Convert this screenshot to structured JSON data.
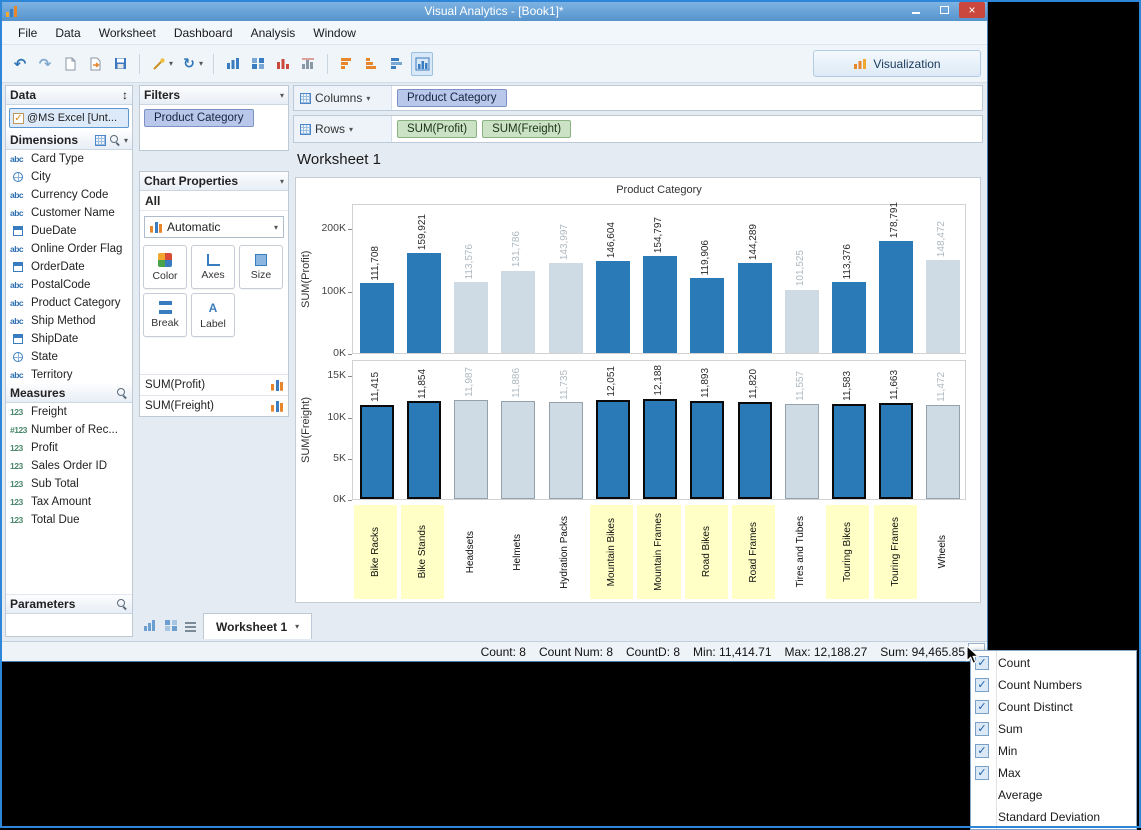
{
  "window": {
    "title": "Visual Analytics - [Book1]*"
  },
  "icons": {
    "caret_down": "▾",
    "updown": "↕",
    "undo": "↶",
    "redo": "↷",
    "refresh": "↻",
    "check": "✓",
    "close": "×"
  },
  "menu_bar": {
    "items": [
      "File",
      "Data",
      "Worksheet",
      "Dashboard",
      "Analysis",
      "Window"
    ]
  },
  "toolbar": {
    "visualization_label": "Visualization"
  },
  "data_panel": {
    "header": "Data",
    "connection": {
      "label": "@MS Excel [Unt...",
      "checked": true
    },
    "dimensions": {
      "header": "Dimensions",
      "fields": [
        {
          "icon": "abc",
          "label": "Card Type"
        },
        {
          "icon": "globe",
          "label": "City"
        },
        {
          "icon": "abc",
          "label": "Currency Code"
        },
        {
          "icon": "abc",
          "label": "Customer Name"
        },
        {
          "icon": "calendar",
          "label": "DueDate"
        },
        {
          "icon": "abc",
          "label": "Online Order Flag"
        },
        {
          "icon": "calendar",
          "label": "OrderDate"
        },
        {
          "icon": "abc",
          "label": "PostalCode"
        },
        {
          "icon": "abc",
          "label": "Product Category"
        },
        {
          "icon": "abc",
          "label": "Ship Method"
        },
        {
          "icon": "calendar",
          "label": "ShipDate"
        },
        {
          "icon": "globe",
          "label": "State"
        },
        {
          "icon": "abc",
          "label": "Territory"
        }
      ]
    },
    "measures": {
      "header": "Measures",
      "fields": [
        {
          "icon": "123",
          "label": "Freight"
        },
        {
          "icon": "#123",
          "label": "Number of Rec..."
        },
        {
          "icon": "123",
          "label": "Profit"
        },
        {
          "icon": "123",
          "label": "Sales Order ID"
        },
        {
          "icon": "123",
          "label": "Sub Total"
        },
        {
          "icon": "123",
          "label": "Tax Amount"
        },
        {
          "icon": "123",
          "label": "Total Due"
        }
      ]
    },
    "parameters": {
      "header": "Parameters"
    }
  },
  "filters_panel": {
    "header": "Filters",
    "fields": [
      "Product Category"
    ]
  },
  "chart_properties": {
    "header": "Chart Properties",
    "scope": "All",
    "mark_type": "Automatic",
    "buttons": [
      {
        "label": "Color",
        "icon": "color"
      },
      {
        "label": "Axes",
        "icon": "axes"
      },
      {
        "label": "Size",
        "icon": "size"
      },
      {
        "label": "Break",
        "icon": "break"
      },
      {
        "label": "Label",
        "icon": "labelA"
      }
    ],
    "fields": [
      "SUM(Profit)",
      "SUM(Freight)"
    ]
  },
  "shelves": {
    "columns": {
      "label": "Columns",
      "pills": [
        {
          "text": "Product Category",
          "type": "dimension"
        }
      ]
    },
    "rows": {
      "label": "Rows",
      "pills": [
        {
          "text": "SUM(Profit)",
          "type": "measure"
        },
        {
          "text": "SUM(Freight)",
          "type": "measure"
        }
      ]
    }
  },
  "sheet": {
    "title": "Worksheet 1",
    "tab_label": "Worksheet 1"
  },
  "chart_data": {
    "type": "bar",
    "title": "Product Category",
    "categories": [
      "Bike Racks",
      "Bike Stands",
      "Headsets",
      "Helmets",
      "Hydration Packs",
      "Mountain Bikes",
      "Mountain Frames",
      "Road Bikes",
      "Road Frames",
      "Tires and Tubes",
      "Touring Bikes",
      "Touring Frames",
      "Wheels"
    ],
    "selected": [
      true,
      true,
      false,
      false,
      false,
      true,
      true,
      true,
      true,
      false,
      true,
      true,
      false
    ],
    "subplots": [
      {
        "ylabel": "SUM(Profit)",
        "ylim": [
          0,
          240000
        ],
        "yticks": [
          {
            "label": "0K",
            "value": 0
          },
          {
            "label": "100K",
            "value": 100000
          },
          {
            "label": "200K",
            "value": 200000
          }
        ],
        "values": [
          111708,
          159921,
          113576,
          131786,
          143997,
          146604,
          154797,
          119906,
          144289,
          101525,
          113376,
          178791,
          148472
        ],
        "labels": [
          "111,708",
          "159,921",
          "113,576",
          "131,786",
          "143,997",
          "146,604",
          "154,797",
          "119,906",
          "144,289",
          "101,525",
          "113,376",
          "178,791",
          "148,472"
        ]
      },
      {
        "ylabel": "SUM(Freight)",
        "ylim": [
          0,
          17000
        ],
        "yticks": [
          {
            "label": "0K",
            "value": 0
          },
          {
            "label": "5K",
            "value": 5000
          },
          {
            "label": "10K",
            "value": 10000
          },
          {
            "label": "15K",
            "value": 15000
          }
        ],
        "values": [
          11415,
          11854,
          11987,
          11886,
          11735,
          12051,
          12188,
          11893,
          11820,
          11557,
          11583,
          11663,
          11472
        ],
        "labels": [
          "11,415",
          "11,854",
          "11,987",
          "11,886",
          "11,735",
          "12,051",
          "12,188",
          "11,893",
          "11,820",
          "11,557",
          "11,583",
          "11,663",
          "11,472"
        ]
      }
    ],
    "colors": {
      "selected_bar": "#2a7ab8",
      "unselected_bar": "#cfdbe4",
      "highlight_label_bg": "#ffffc6"
    },
    "legend": "none",
    "grid": false
  },
  "status_bar": {
    "segments": [
      "Count: 8",
      "Count Num: 8",
      "CountD: 8",
      "Min: 11,414.71",
      "Max: 12,188.27",
      "Sum: 94,465.85"
    ]
  },
  "context_menu": {
    "items": [
      {
        "label": "Count",
        "checked": true
      },
      {
        "label": "Count Numbers",
        "checked": true
      },
      {
        "label": "Count Distinct",
        "checked": true
      },
      {
        "label": "Sum",
        "checked": true
      },
      {
        "label": "Min",
        "checked": true
      },
      {
        "label": "Max",
        "checked": true
      },
      {
        "label": "Average",
        "checked": false
      },
      {
        "label": "Standard Deviation",
        "checked": false
      }
    ]
  }
}
